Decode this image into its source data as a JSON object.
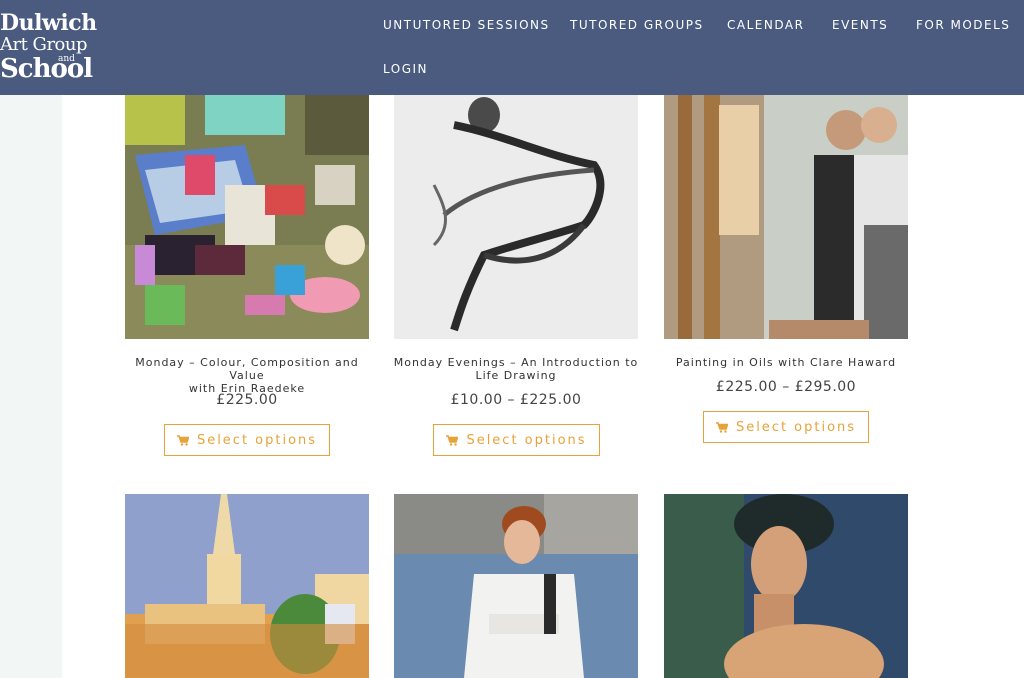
{
  "header": {
    "logo": {
      "line1": "Dulwich",
      "line2": "Art Group",
      "line3": "and",
      "line4": "School"
    },
    "nav": [
      {
        "label": "UNTUTORED SESSIONS"
      },
      {
        "label": "TUTORED GROUPS"
      },
      {
        "label": "CALENDAR"
      },
      {
        "label": "EVENTS"
      },
      {
        "label": "FOR MODELS"
      },
      {
        "label": "LOGIN"
      }
    ]
  },
  "products": [
    {
      "title_line1": "Monday – Colour, Composition and Value",
      "title_line2": "with Erin Raedeke",
      "price": "£225.00",
      "button": "Select options"
    },
    {
      "title_line1": "Monday Evenings – An Introduction to",
      "title_line2": "Life Drawing",
      "price": "£10.00 – £225.00",
      "button": "Select options"
    },
    {
      "title_line1": "Painting in Oils with Clare Haward",
      "title_line2": "",
      "price": "£225.00 – £295.00",
      "button": "Select options"
    }
  ],
  "colors": {
    "header_bg": "#4a5b7f",
    "accent": "#e7a33a",
    "sidebar": "#f2f6f5"
  }
}
